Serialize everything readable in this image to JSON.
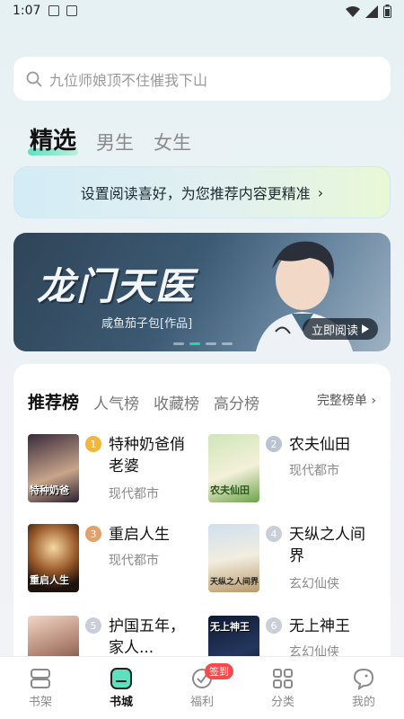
{
  "status_bar": {
    "time": "1:07"
  },
  "search": {
    "placeholder": "九位师娘顶不住催我下山"
  },
  "tabs": [
    "精选",
    "男生",
    "女生"
  ],
  "preference_bar": {
    "text": "设置阅读喜好，为您推荐内容更精准",
    "chevron": "›"
  },
  "banner": {
    "title": "龙门天医",
    "author": "咸鱼茄子包[作品]",
    "button_label": "立即阅读",
    "active_dot": 1
  },
  "ranking": {
    "tabs": [
      "推荐榜",
      "人气榜",
      "收藏榜",
      "高分榜"
    ],
    "all_label": "完整榜单",
    "books": [
      {
        "rank": "1",
        "name": "特种奶爸俏老婆",
        "category": "现代都市",
        "cover_text": "特种奶爸"
      },
      {
        "rank": "2",
        "name": "农夫仙田",
        "category": "现代都市",
        "cover_text": "农夫仙田"
      },
      {
        "rank": "3",
        "name": "重启人生",
        "category": "现代都市",
        "cover_text": "重启人生"
      },
      {
        "rank": "4",
        "name": "天纵之人间界",
        "category": "玄幻仙侠",
        "cover_text": "天纵之人间界"
      },
      {
        "rank": "5",
        "name": "护国五年，家人...",
        "category": "",
        "cover_text": ""
      },
      {
        "rank": "6",
        "name": "无上神王",
        "category": "玄幻仙侠",
        "cover_text": "无上神王"
      }
    ]
  },
  "bottom_nav": [
    {
      "label": "书架",
      "icon": "bookshelf-icon"
    },
    {
      "label": "书城",
      "icon": "bookstore-icon",
      "active": true
    },
    {
      "label": "福利",
      "icon": "gift-icon",
      "badge": "签到"
    },
    {
      "label": "分类",
      "icon": "category-grid-icon"
    },
    {
      "label": "我的",
      "icon": "profile-icon"
    }
  ]
}
